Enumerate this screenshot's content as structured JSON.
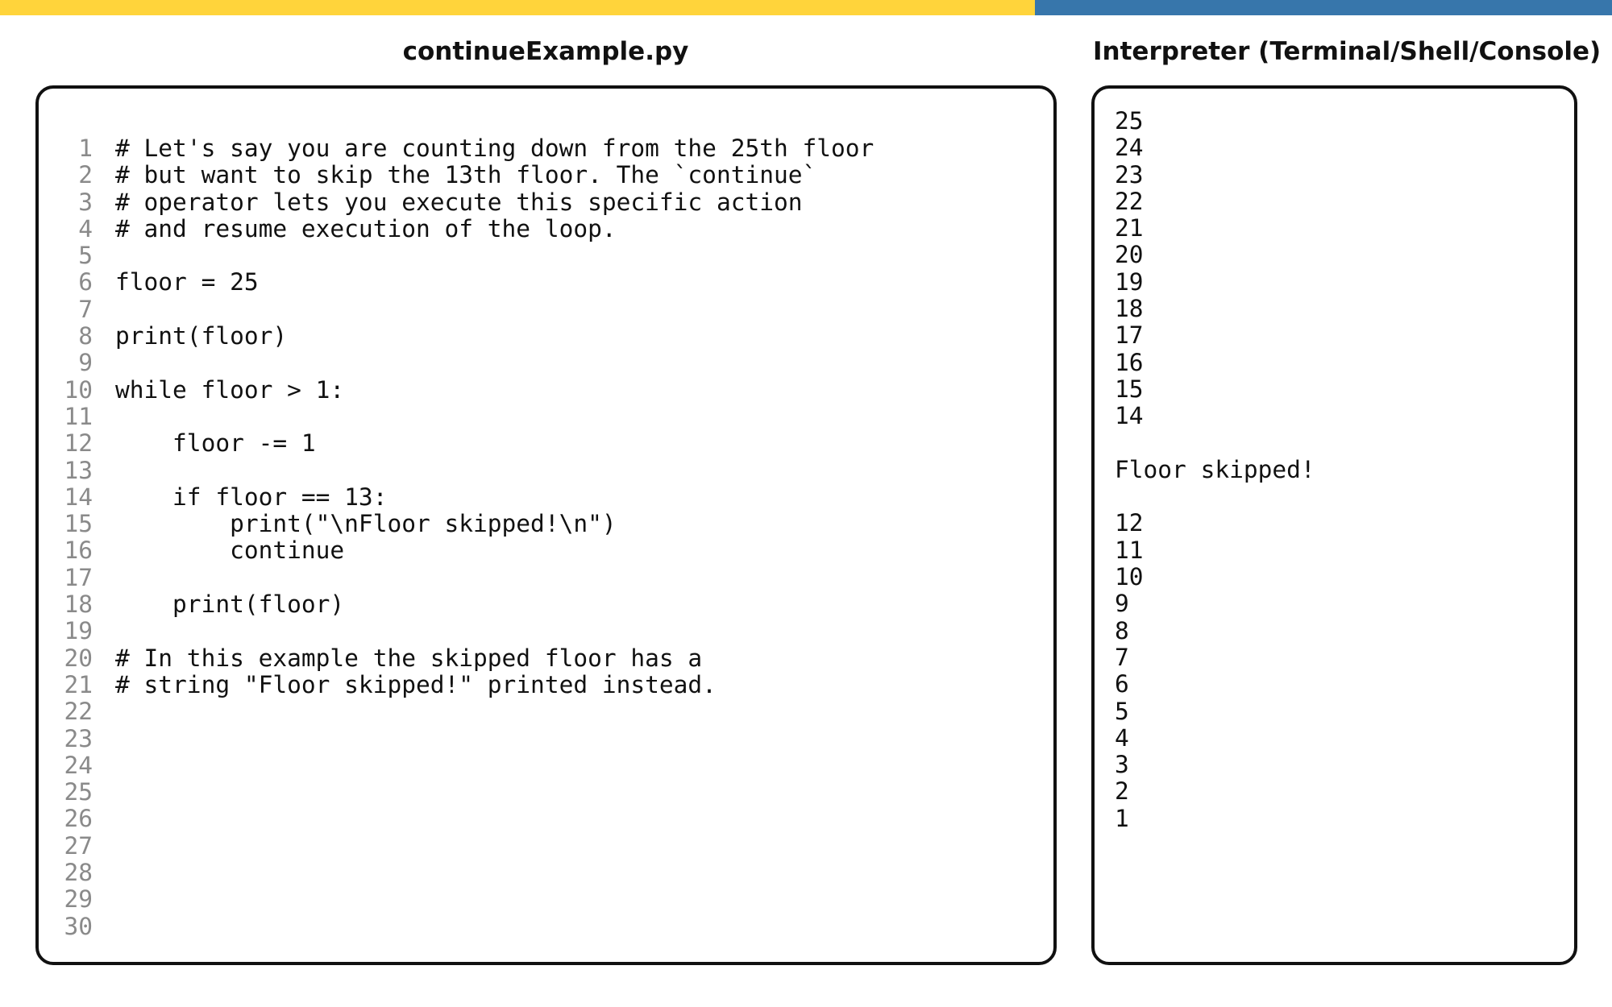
{
  "colors": {
    "top_bar_left": "#FFD43B",
    "top_bar_right": "#3776AB",
    "border": "#111111",
    "line_number": "#8a8a8a"
  },
  "editor": {
    "title": "continueExample.py",
    "lines": [
      {
        "num": "1",
        "text": "# Let's say you are counting down from the 25th floor"
      },
      {
        "num": "2",
        "text": "# but want to skip the 13th floor. The `continue`"
      },
      {
        "num": "3",
        "text": "# operator lets you execute this specific action"
      },
      {
        "num": "4",
        "text": "# and resume execution of the loop."
      },
      {
        "num": "5",
        "text": ""
      },
      {
        "num": "6",
        "text": "floor = 25"
      },
      {
        "num": "7",
        "text": ""
      },
      {
        "num": "8",
        "text": "print(floor)"
      },
      {
        "num": "9",
        "text": ""
      },
      {
        "num": "10",
        "text": "while floor > 1:"
      },
      {
        "num": "11",
        "text": ""
      },
      {
        "num": "12",
        "text": "    floor -= 1"
      },
      {
        "num": "13",
        "text": ""
      },
      {
        "num": "14",
        "text": "    if floor == 13:"
      },
      {
        "num": "15",
        "text": "        print(\"\\nFloor skipped!\\n\")"
      },
      {
        "num": "16",
        "text": "        continue"
      },
      {
        "num": "17",
        "text": ""
      },
      {
        "num": "18",
        "text": "    print(floor)"
      },
      {
        "num": "19",
        "text": ""
      },
      {
        "num": "20",
        "text": "# In this example the skipped floor has a"
      },
      {
        "num": "21",
        "text": "# string \"Floor skipped!\" printed instead."
      },
      {
        "num": "22",
        "text": ""
      },
      {
        "num": "23",
        "text": ""
      },
      {
        "num": "24",
        "text": ""
      },
      {
        "num": "25",
        "text": ""
      },
      {
        "num": "26",
        "text": ""
      },
      {
        "num": "27",
        "text": ""
      },
      {
        "num": "28",
        "text": ""
      },
      {
        "num": "29",
        "text": ""
      },
      {
        "num": "30",
        "text": ""
      }
    ]
  },
  "terminal": {
    "title": "Interpreter (Terminal/Shell/Console)",
    "lines": [
      "25",
      "24",
      "23",
      "22",
      "21",
      "20",
      "19",
      "18",
      "17",
      "16",
      "15",
      "14",
      "",
      "Floor skipped!",
      "",
      "12",
      "11",
      "10",
      "9",
      "8",
      "7",
      "6",
      "5",
      "4",
      "3",
      "2",
      "1"
    ]
  }
}
